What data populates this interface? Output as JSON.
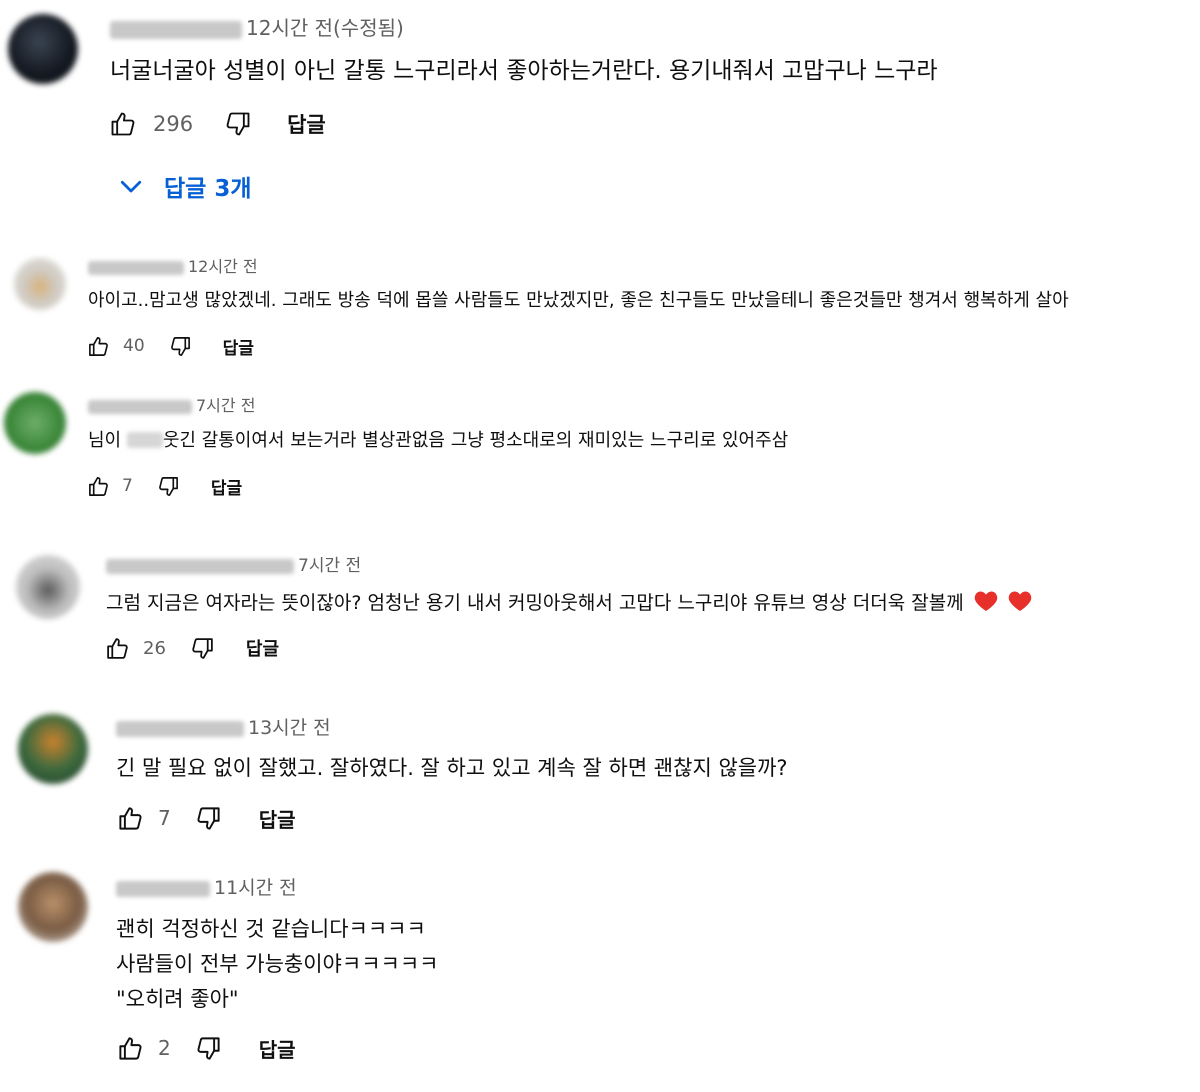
{
  "colors": {
    "link": "#065fd4",
    "meta": "#606060",
    "text": "#0f0f0f",
    "heart": "#e8302a"
  },
  "comments": [
    {
      "timestamp": "12시간 전(수정됨)",
      "lines": [
        "너굴너굴아 성별이 아닌 갈통 느구리라서 좋아하는거란다. 용기내줘서 고맙구나 느구라"
      ],
      "likes": "296",
      "reply_label": "답글",
      "replies_toggle": "답글 3개"
    },
    {
      "timestamp": "12시간 전",
      "lines": [
        "아이고..맘고생 많았겠네. 그래도 방송 덕에 몹쓸 사람들도 만났겠지만, 좋은 친구들도 만났을테니 좋은것들만 챙겨서 행복하게 살아"
      ],
      "likes": "40",
      "reply_label": "답글"
    },
    {
      "timestamp": "7시간 전",
      "text_before": "님이 ",
      "text_after": "웃긴 갈통이여서 보는거라 별상관없음 그냥 평소대로의 재미있는 느구리로 있어주삼",
      "likes": "7",
      "reply_label": "답글"
    },
    {
      "timestamp": "7시간 전",
      "lines": [
        "그럼 지금은 여자라는 뜻이잖아? 엄청난 용기 내서 커밍아웃해서 고맙다 느구리야 유튜브 영상 더더욱 잘볼께"
      ],
      "likes": "26",
      "reply_label": "답글"
    },
    {
      "timestamp": "13시간 전",
      "lines": [
        "긴 말 필요 없이 잘했고. 잘하였다. 잘 하고 있고 계속 잘 하면 괜찮지 않을까?"
      ],
      "likes": "7",
      "reply_label": "답글"
    },
    {
      "timestamp": "11시간 전",
      "lines": [
        "괜히 걱정하신 것 같습니다ㅋㅋㅋㅋ",
        "사람들이 전부 가능충이야ㅋㅋㅋㅋㅋ",
        "\"오히려 좋아\""
      ],
      "likes": "2",
      "reply_label": "답글"
    }
  ]
}
